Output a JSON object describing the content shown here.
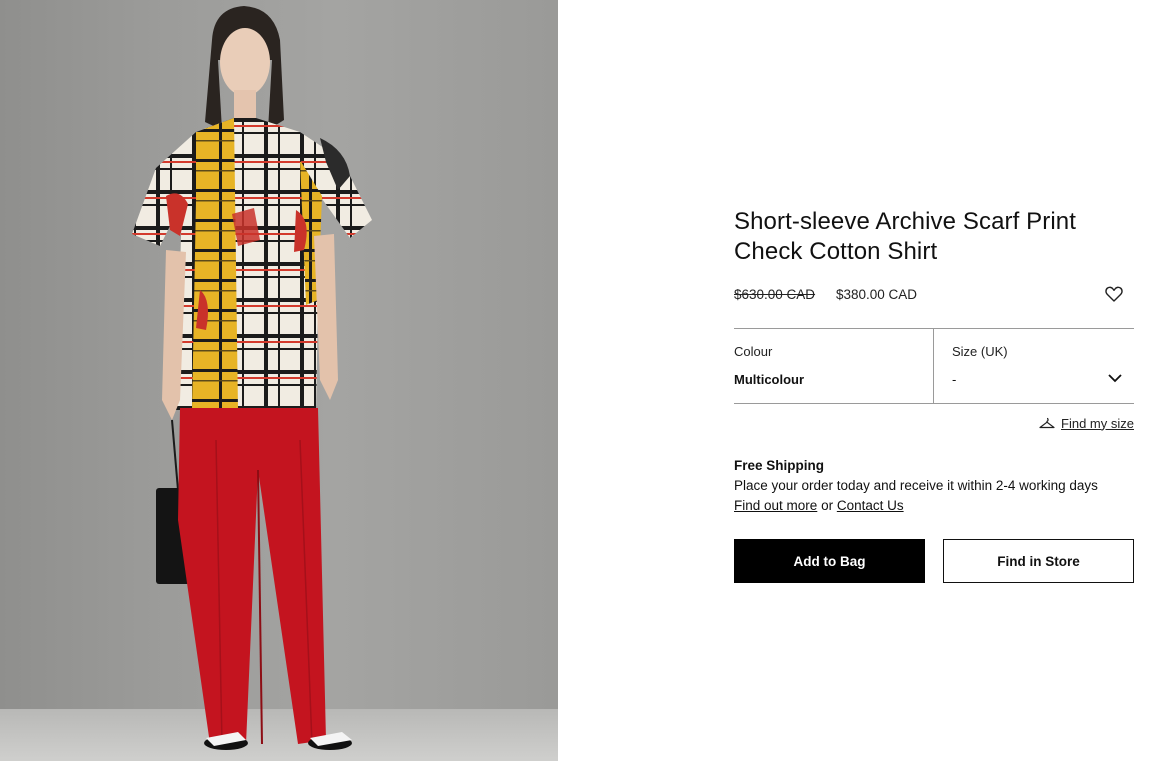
{
  "product": {
    "title_line1": "Short-sleeve Archive Scarf Print",
    "title_line2": "Check Cotton Shirt",
    "price_original": "$630.00 CAD",
    "price_sale": "$380.00 CAD"
  },
  "selectors": {
    "colour_label": "Colour",
    "colour_value": "Multicolour",
    "size_label": "Size (UK)",
    "size_value": "-"
  },
  "size_help": {
    "label": "Find my size",
    "icon": "hanger-icon"
  },
  "shipping": {
    "heading": "Free Shipping",
    "text": "Place your order today and receive it within 2-4 working days",
    "link_find_out": "Find out more",
    "connector": "or",
    "link_contact": "Contact Us"
  },
  "actions": {
    "add_to_bag": "Add to Bag",
    "find_in_store": "Find in Store"
  },
  "icons": {
    "wishlist": "heart-icon",
    "dropdown": "chevron-down-icon"
  },
  "colors": {
    "primary_button": "#000000",
    "text": "#111111",
    "divider": "#9a9a9a"
  }
}
